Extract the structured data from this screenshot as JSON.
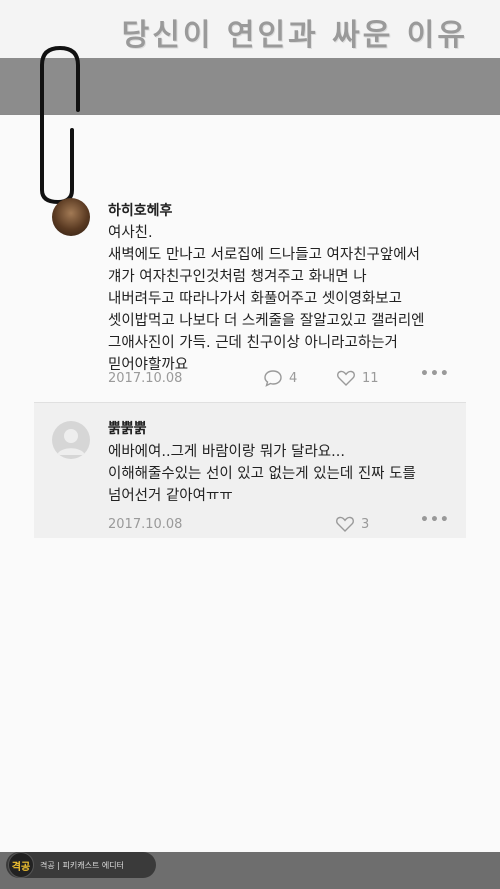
{
  "header": {
    "title": "당신이 연인과 싸운 이유"
  },
  "comments": [
    {
      "author": "하히호헤후",
      "text": "여사친.\n새벽에도 만나고 서로집에 드나들고 여자친구앞에서\n걔가 여자친구인것처럼 챙겨주고 화내면 나\n내버려두고 따라나가서 화풀어주고 셋이영화보고\n셋이밥먹고 나보다 더 스케줄을 잘알고있고 갤러리엔\n그애사진이 가득. 근데 친구이상 아니라고하는거\n믿어야할까요",
      "date": "2017.10.08",
      "comments_count": "4",
      "likes": "11",
      "more": "•••"
    },
    {
      "author": "뿕뿕뿕",
      "text": "에바에여..그게 바람이랑 뭐가 달라요...\n이해해줄수있는 선이 있고 없는게 있는데 진짜 도를\n넘어선거 같아여ㅠㅠ",
      "date": "2017.10.08",
      "likes": "3",
      "more": "•••"
    }
  ],
  "footer": {
    "logo": "격공",
    "text": "격공 | 피키캐스트 에디터"
  },
  "icons": {
    "comment": "speech-bubble-icon",
    "like": "heart-icon",
    "clip": "paperclip-icon"
  }
}
